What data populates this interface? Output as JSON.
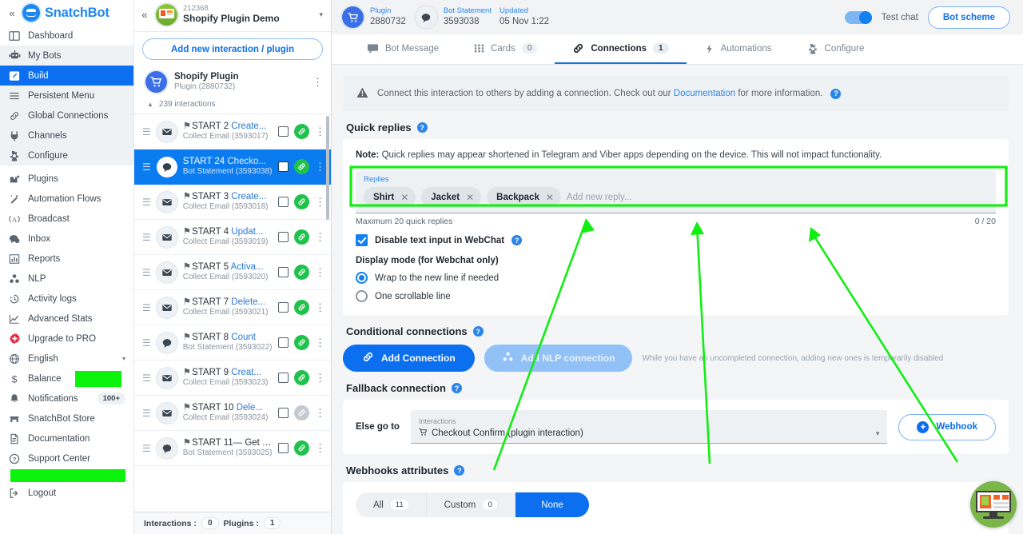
{
  "brand": {
    "name": "SnatchBot",
    "collapse_icon": "double-chevron-left"
  },
  "sidebar": {
    "items": [
      {
        "label": "Dashboard",
        "icon": "dashboard-icon"
      },
      {
        "label": "My Bots",
        "icon": "robot-icon"
      },
      {
        "label": "Build",
        "icon": "pencil-square-icon",
        "active": true
      },
      {
        "label": "Persistent Menu",
        "icon": "menu-icon"
      },
      {
        "label": "Global Connections",
        "icon": "link-icon"
      },
      {
        "label": "Channels",
        "icon": "plug-icon"
      },
      {
        "label": "Configure",
        "icon": "gear-icon"
      },
      {
        "label": "Plugins",
        "icon": "plugin-icon"
      },
      {
        "label": "Automation Flows",
        "icon": "magic-wand-icon"
      },
      {
        "label": "Broadcast",
        "icon": "broadcast-icon"
      },
      {
        "label": "Inbox",
        "icon": "chat-icon"
      },
      {
        "label": "Reports",
        "icon": "bar-chart-icon"
      },
      {
        "label": "NLP",
        "icon": "nodes-icon"
      },
      {
        "label": "Activity logs",
        "icon": "history-icon"
      },
      {
        "label": "Advanced Stats",
        "icon": "line-chart-icon"
      },
      {
        "label": "Upgrade to PRO",
        "icon": "plus-gear-icon"
      },
      {
        "label": "English",
        "icon": "globe-icon",
        "caret": "▾"
      },
      {
        "label": "Balance",
        "icon": "dollar-icon",
        "redacted": true
      },
      {
        "label": "Notifications",
        "icon": "bell-icon",
        "badge": "100+"
      },
      {
        "label": "SnatchBot Store",
        "icon": "store-icon"
      },
      {
        "label": "Documentation",
        "icon": "document-icon"
      },
      {
        "label": "Support Center",
        "icon": "question-circle-icon"
      },
      {
        "label": "",
        "icon": "redacted-icon",
        "redacted_full": true
      },
      {
        "label": "Logout",
        "icon": "logout-icon"
      }
    ]
  },
  "interactions_panel": {
    "collapse_icon": "double-chevron-left",
    "bot": {
      "id": "212368",
      "name": "Shopify Plugin Demo",
      "caret": "▾"
    },
    "add_new_button": "Add new interaction / plugin",
    "plugin": {
      "name": "Shopify Plugin",
      "sub": "Plugin (2880732)"
    },
    "interactions_header": "239 interactions",
    "rows": [
      {
        "title": "START 2 ",
        "who": "Create...",
        "sub": "Collect Email (3593017)",
        "type": "email",
        "linked": true,
        "selected": false
      },
      {
        "title": "START 24 ",
        "who": "Checko...",
        "sub": "Bot Statement (3593038)",
        "type": "chat",
        "linked": true,
        "selected": true,
        "plain": true
      },
      {
        "title": "START 3 ",
        "who": "Create...",
        "sub": "Collect Email (3593018)",
        "type": "email",
        "linked": true,
        "selected": false
      },
      {
        "title": "START 4 ",
        "who": "Updat...",
        "sub": "Collect Email (3593019)",
        "type": "email",
        "linked": true,
        "selected": false
      },
      {
        "title": "START 5 ",
        "who": "Activa...",
        "sub": "Collect Email (3593020)",
        "type": "email",
        "linked": true,
        "selected": false
      },
      {
        "title": "START 7 ",
        "who": "Delete...",
        "sub": "Collect Email (3593021)",
        "type": "email",
        "linked": true,
        "selected": false
      },
      {
        "title": "START 8 ",
        "who": "Count",
        "sub": "Bot Statement (3593022)",
        "type": "chat",
        "linked": true,
        "selected": false
      },
      {
        "title": "START 9 ",
        "who": "Creat...",
        "sub": "Collect Email (3593023)",
        "type": "email",
        "linked": true,
        "selected": false
      },
      {
        "title": "START 10 ",
        "who": "Dele...",
        "sub": "Collect Email (3593024)",
        "type": "email",
        "linked": false,
        "selected": false
      },
      {
        "title": "START 11",
        "who": "— Get Y...",
        "sub": "Bot Statement (3593025)",
        "type": "chat",
        "linked": true,
        "selected": false
      }
    ],
    "footer": {
      "interactions_label": "Interactions :",
      "interactions_count": "0",
      "plugins_label": "Plugins :",
      "plugins_count": "1"
    }
  },
  "header": {
    "plugin_label": "Plugin",
    "plugin_value": "2880732",
    "statement_label": "Bot Statement",
    "statement_value": "3593038",
    "updated_label": "Updated",
    "updated_value": "05 Nov 1:22",
    "test_chat_label": "Test chat",
    "bot_scheme_label": "Bot scheme"
  },
  "tabs": [
    {
      "label": "Bot Message",
      "icon": "message-icon",
      "count": null,
      "active": false
    },
    {
      "label": "Cards",
      "icon": "grid-icon",
      "count": "0",
      "active": false
    },
    {
      "label": "Connections",
      "icon": "link-icon",
      "count": "1",
      "active": true
    },
    {
      "label": "Automations",
      "icon": "lightning-icon",
      "count": null,
      "active": false
    },
    {
      "label": "Configure",
      "icon": "gear-icon",
      "count": null,
      "active": false
    }
  ],
  "notice": {
    "icon": "warning-triangle-icon",
    "text_before": "Connect this interaction to others by adding a connection. Check out our ",
    "link": "Documentation",
    "text_after": " for more information."
  },
  "quick_replies": {
    "section_title": "Quick replies",
    "note_bold": "Note:",
    "note_text": " Quick replies may appear shortened in Telegram and Viber apps depending on the device. This will not impact functionality.",
    "field_label": "Replies",
    "chips": [
      "Shirt",
      "Jacket",
      "Backpack"
    ],
    "placeholder": "Add new reply...",
    "hint": "Maximum 20 quick replies",
    "counter": "0 / 20",
    "disable_input_label": "Disable text input in WebChat",
    "display_mode_title": "Display mode (for Webchat only)",
    "options": [
      {
        "label": "Wrap to the new line if needed",
        "selected": true
      },
      {
        "label": "One scrollable line",
        "selected": false
      }
    ]
  },
  "conditional": {
    "section_title": "Conditional connections",
    "add_connection": "Add Connection",
    "add_nlp_connection": "Add NLP connection",
    "disabled_note": "While you have an uncompleted connection, adding new ones is temporarily disabled"
  },
  "fallback": {
    "section_title": "Fallback connection",
    "else_label": "Else go to",
    "select_label": "Interactions",
    "select_value": "Checkout Confirm (plugin interaction)",
    "webhook_button": "Webhook"
  },
  "webhooks": {
    "section_title": "Webhooks attributes",
    "segments": [
      {
        "label": "All",
        "count": "11",
        "active": false
      },
      {
        "label": "Custom",
        "count": "0",
        "active": false
      },
      {
        "label": "None",
        "count": null,
        "active": true
      }
    ]
  },
  "annotations": {
    "highlight_color": "#11ee11",
    "arrow_count": 3,
    "highlight_target": "quick-replies-field"
  },
  "widget": {
    "name": "help-widget"
  }
}
